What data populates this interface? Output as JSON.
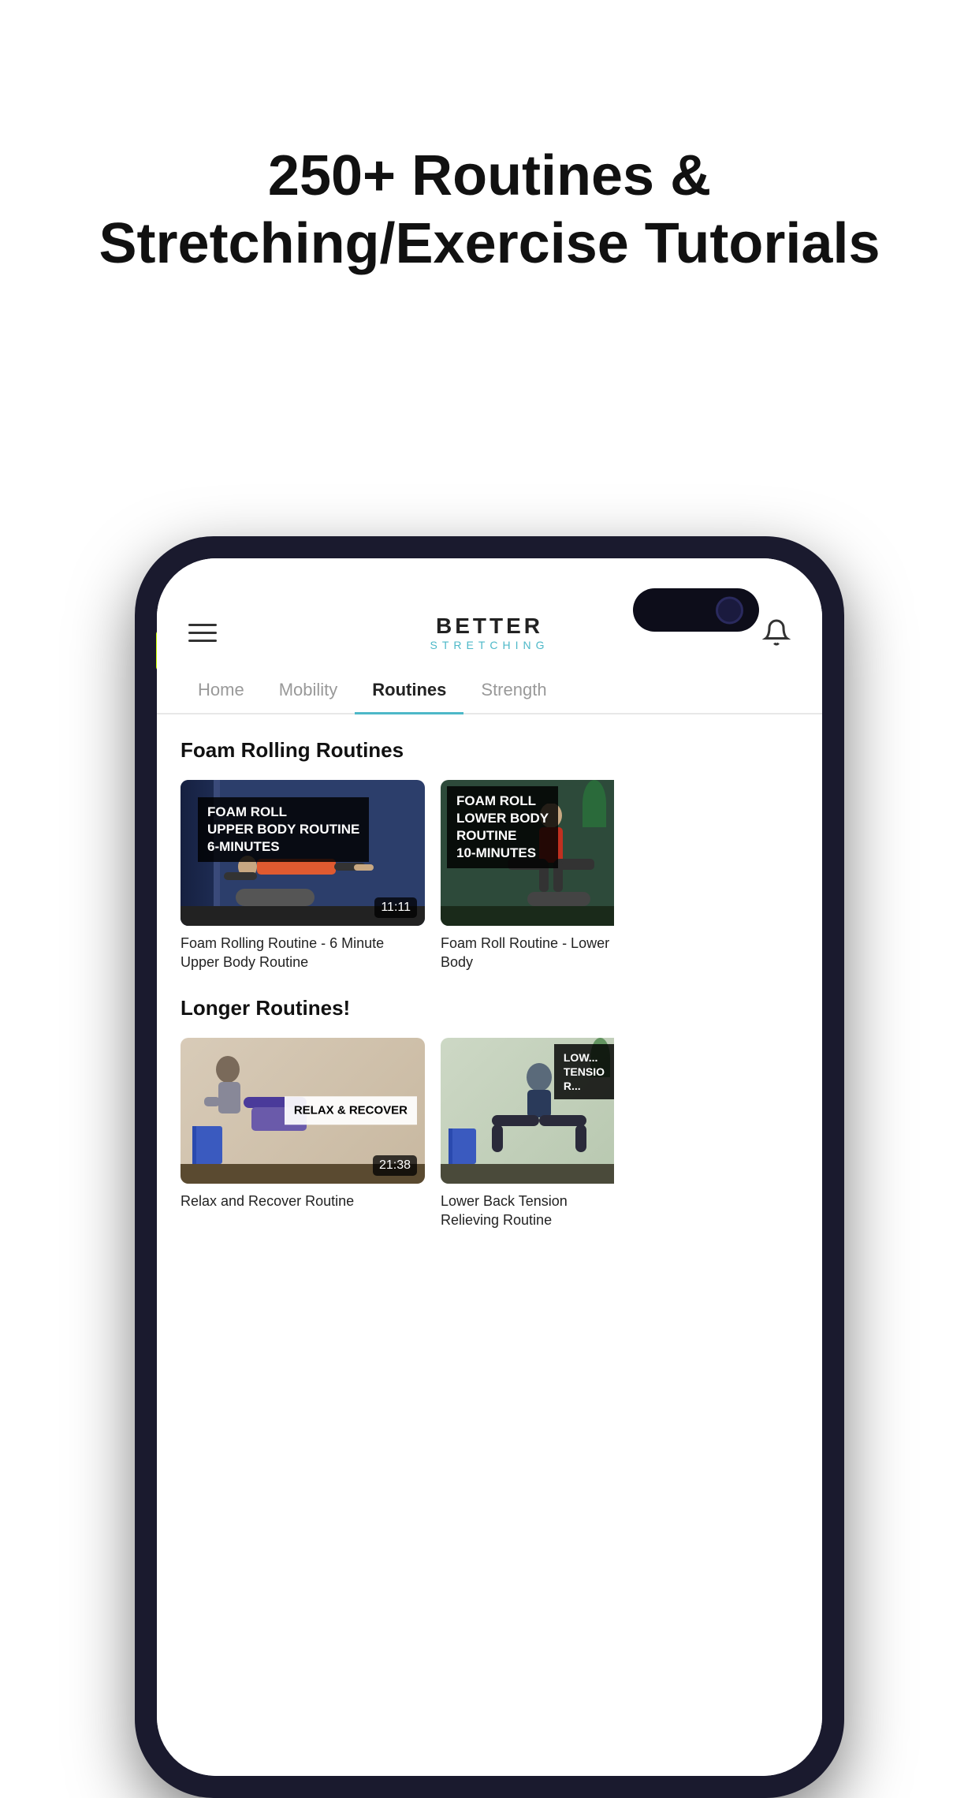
{
  "promo": {
    "headline": "250+ Routines & Stretching/Exercise Tutorials"
  },
  "app": {
    "logo_better": "BETTER",
    "logo_stretching": "STRETCHING",
    "nav_tabs": [
      {
        "id": "home",
        "label": "Home",
        "active": false
      },
      {
        "id": "mobility",
        "label": "Mobility",
        "active": false
      },
      {
        "id": "routines",
        "label": "Routines",
        "active": true
      },
      {
        "id": "strength",
        "label": "Strength",
        "active": false
      }
    ],
    "sections": [
      {
        "id": "foam-rolling",
        "title": "Foam Rolling Routines",
        "videos": [
          {
            "id": "foam-upper",
            "thumb_label": "FOAM ROLL\nUPPER BODY ROUTINE\n6-MINUTES",
            "duration": "11:11",
            "title": "Foam Rolling Routine - 6 Minute Upper Body Routine"
          },
          {
            "id": "foam-lower",
            "thumb_label": "FOAM ROLL\nLOWER BODY\nROUTINE\n10-MINUTES",
            "duration": "",
            "title": "Foam Roll Routine - Lower Body"
          }
        ]
      },
      {
        "id": "longer-routines",
        "title": "Longer Routines!",
        "videos": [
          {
            "id": "relax-recover",
            "thumb_label": "RELAX & RECOVER",
            "duration": "21:38",
            "title": "Relax and Recover Routine"
          },
          {
            "id": "lower-back",
            "thumb_label": "LOWER BACK\nTENSION\nR...",
            "duration": "",
            "title": "Lower Back Tension Relieving Routine"
          }
        ]
      }
    ]
  }
}
